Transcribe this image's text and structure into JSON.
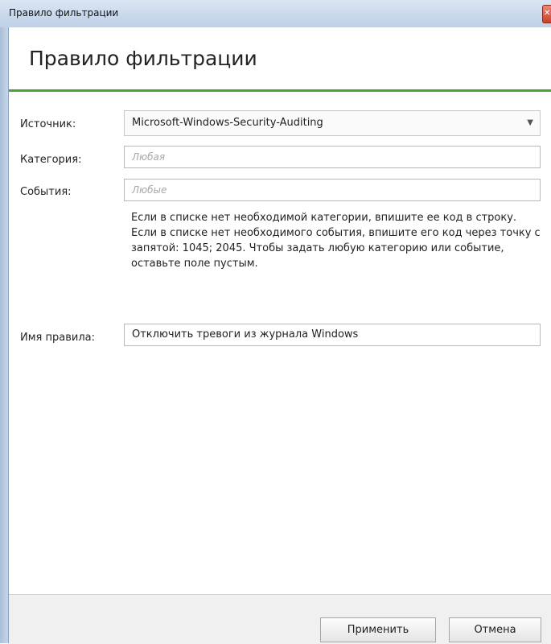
{
  "window": {
    "title": "Правило фильтрации"
  },
  "header": {
    "title": "Правило фильтрации",
    "accent_color": "#4aa233"
  },
  "form": {
    "source": {
      "label": "Источник:",
      "value": "Microsoft-Windows-Security-Auditing"
    },
    "category": {
      "label": "Категория:",
      "placeholder": "Любая"
    },
    "events": {
      "label": "События:",
      "placeholder": "Любые"
    },
    "help_text": "Если в списке нет необходимой категории, впишите ее код в строку. Если в списке нет необходимого события, впишите его код через точку с запятой: 1045; 2045. Чтобы задать любую категорию или событие, оставьте поле пустым.",
    "rule_name": {
      "label": "Имя правила:",
      "value": "Отключить тревоги из журнала Windows"
    }
  },
  "buttons": {
    "apply": "Применить",
    "cancel": "Отмена"
  }
}
